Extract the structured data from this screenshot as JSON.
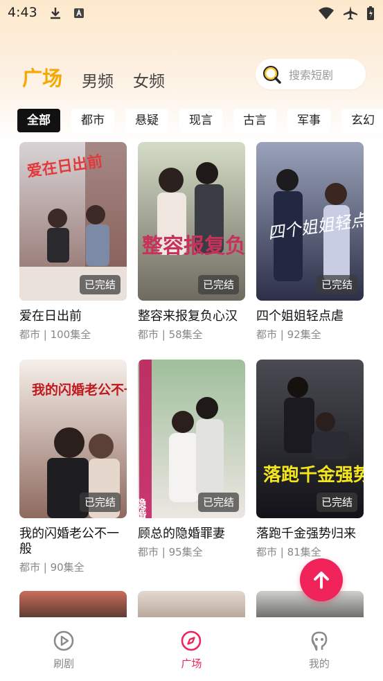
{
  "status_bar": {
    "time": "4:43"
  },
  "header": {
    "tabs": [
      {
        "label": "广场",
        "active": true
      },
      {
        "label": "男频",
        "active": false
      },
      {
        "label": "女频",
        "active": false
      }
    ],
    "search": {
      "placeholder": "搜索短剧",
      "icon": "search-icon"
    }
  },
  "categories": [
    {
      "label": "全部",
      "active": true
    },
    {
      "label": "都市"
    },
    {
      "label": "悬疑"
    },
    {
      "label": "现言"
    },
    {
      "label": "古言"
    },
    {
      "label": "军事"
    },
    {
      "label": "玄幻"
    }
  ],
  "dramas": [
    {
      "title": "爱在日出前",
      "meta": "都市 | 100集全",
      "badge": "已完结",
      "poster_text": "爱在日出前",
      "colors": [
        "#c9c5c8",
        "#8b6a64"
      ]
    },
    {
      "title": "整容来报复负心汉",
      "meta": "都市 | 58集全",
      "badge": "已完结",
      "poster_text": "整容报复负心汉",
      "colors": [
        "#c7d2b7",
        "#7a7467"
      ]
    },
    {
      "title": "四个姐姐轻点虐",
      "meta": "都市 | 92集全",
      "badge": "已完结",
      "poster_text": "四个姐姐轻点虐",
      "colors": [
        "#7f8aa6",
        "#2c2f47"
      ]
    },
    {
      "title": "我的闪婚老公不一般",
      "meta": "都市 | 90集全",
      "badge": "已完结",
      "poster_text": "我的闪婚老公不一般",
      "colors": [
        "#f1e9e4",
        "#6b4a43"
      ]
    },
    {
      "title": "顾总的隐婚罪妻",
      "meta": "都市 | 95集全",
      "badge": "已完结",
      "poster_text": "隐婚罪妻",
      "colors": [
        "#a9c4a8",
        "#e8e2df"
      ]
    },
    {
      "title": "落跑千金强势归来",
      "meta": "都市 | 81集全",
      "badge": "已完结",
      "poster_text": "落跑千金强势归来",
      "colors": [
        "#3a3a3f",
        "#12121a"
      ]
    }
  ],
  "partial_row_colors": [
    [
      "#c96d5a",
      "#5a3a33"
    ],
    [
      "#e3d8cf",
      "#b7a79a"
    ],
    [
      "#cfcfcb",
      "#6a6a66"
    ]
  ],
  "fab": {
    "icon": "arrow-up-icon",
    "color": "#f0245a"
  },
  "bottom_nav": [
    {
      "label": "刷剧",
      "icon": "play-circle-icon",
      "active": false
    },
    {
      "label": "广场",
      "icon": "compass-icon",
      "active": true
    },
    {
      "label": "我的",
      "icon": "profile-icon",
      "active": false
    }
  ],
  "colors": {
    "accent_yellow": "#f5a800",
    "accent_pink": "#f0245a"
  }
}
